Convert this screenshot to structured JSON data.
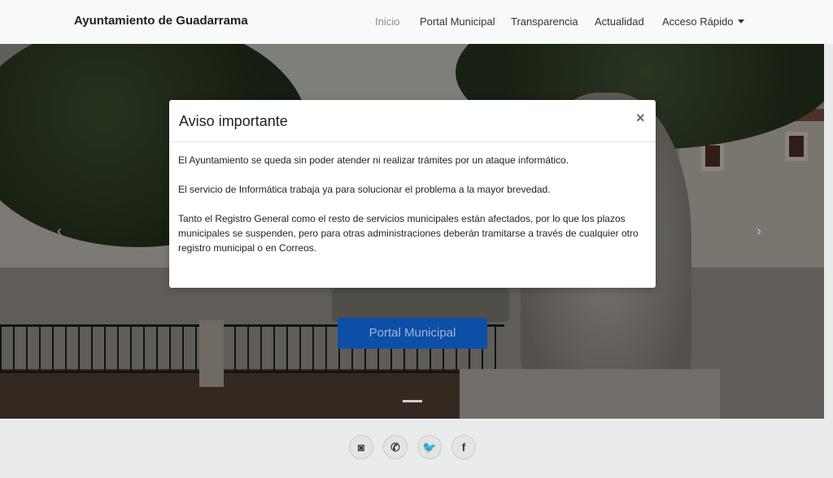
{
  "navbar": {
    "brand": "Ayuntamiento de Guadarrama",
    "items": [
      {
        "label": "Inicio",
        "active": true
      },
      {
        "label": "Portal Municipal"
      },
      {
        "label": "Transparencia"
      },
      {
        "label": "Actualidad"
      },
      {
        "label": "Acceso Rápido",
        "dropdown": true
      }
    ]
  },
  "hero": {
    "prev_icon": "‹",
    "next_icon": "›",
    "cta_label": "Portal Municipal"
  },
  "modal": {
    "title": "Aviso importante",
    "close_glyph": "×",
    "paragraphs": [
      "El Ayuntamiento se queda sin poder atender ni realizar trámites por un ataque informático.",
      "El servicio de Informática trabaja ya para solucionar el problema a la mayor brevedad.",
      "Tanto el Registro General como el resto de servicios municipales están afectados, por lo que los plazos municipales se suspenden, pero para otras administraciones deberán tramitarse a través de cualquier otro registro municipal o en Correos."
    ]
  },
  "social": [
    {
      "name": "instagram-icon",
      "glyph": "◙"
    },
    {
      "name": "whatsapp-icon",
      "glyph": "✆"
    },
    {
      "name": "twitter-icon",
      "glyph": "🐦"
    },
    {
      "name": "facebook-icon",
      "glyph": "f"
    }
  ]
}
